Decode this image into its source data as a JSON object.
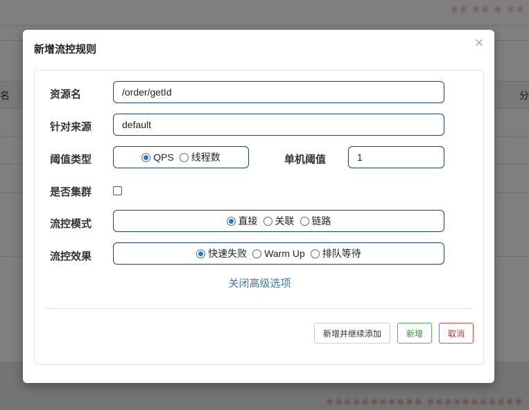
{
  "background": {
    "col_left_text": "名",
    "col_right_text": "分",
    "watermark_top": "※※ ※※ ※ ※※",
    "watermark_bottom": "※※※※※※※※※※※ ※※※※※※※※※※※"
  },
  "modal": {
    "title": "新增流控规则",
    "close_symbol": "×"
  },
  "form": {
    "resource": {
      "label": "资源名",
      "value": "/order/getId"
    },
    "source": {
      "label": "针对来源",
      "value": "default"
    },
    "threshold_type": {
      "label": "阈值类型",
      "options": [
        {
          "label": "QPS",
          "checked": true
        },
        {
          "label": "线程数",
          "checked": false
        }
      ]
    },
    "single_threshold": {
      "label": "单机阈值",
      "value": "1"
    },
    "cluster": {
      "label": "是否集群",
      "checked": false
    },
    "flow_mode": {
      "label": "流控模式",
      "options": [
        {
          "label": "直接",
          "checked": true
        },
        {
          "label": "关联",
          "checked": false
        },
        {
          "label": "链路",
          "checked": false
        }
      ]
    },
    "flow_effect": {
      "label": "流控效果",
      "options": [
        {
          "label": "快速失败",
          "checked": true
        },
        {
          "label": "Warm Up",
          "checked": false
        },
        {
          "label": "排队等待",
          "checked": false
        }
      ]
    },
    "advanced_toggle": "关闭高级选项"
  },
  "footer": {
    "add_continue_label": "新增并继续添加",
    "add_label": "新增",
    "cancel_label": "取消"
  },
  "colors": {
    "accent": "#2f74d0",
    "link": "#3a78b8",
    "success": "#5cae5c",
    "danger": "#d9534f",
    "input_border": "#1f3f6e"
  }
}
